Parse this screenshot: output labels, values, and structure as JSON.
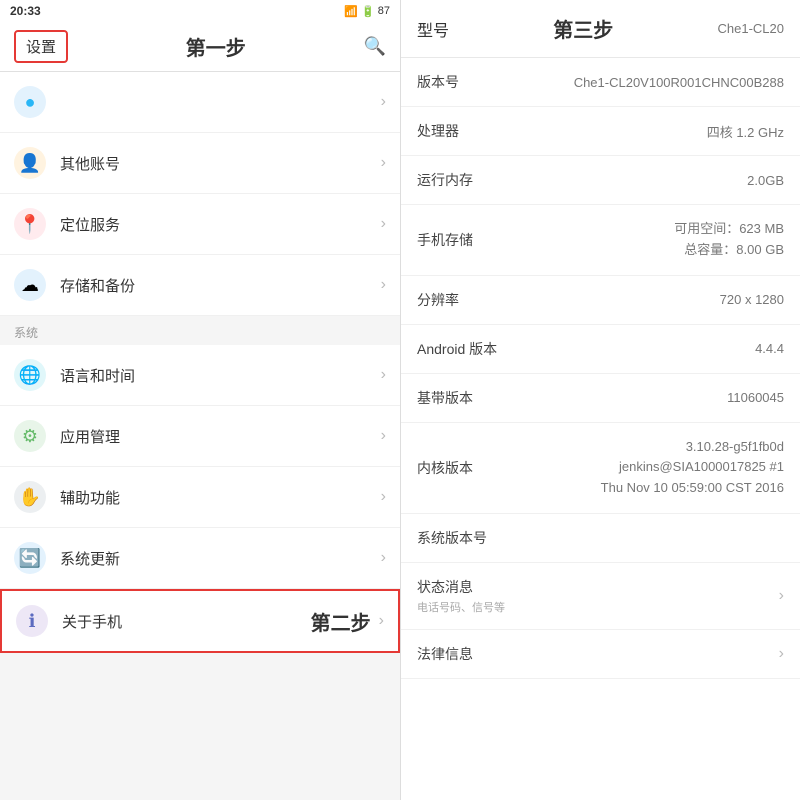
{
  "left": {
    "status_bar": {
      "time": "20:33",
      "battery": "87",
      "icons": "● ▣ ▣"
    },
    "top_bar": {
      "settings_label": "设置",
      "title": "第一步",
      "search_icon": "🔍"
    },
    "sections": [
      {
        "label": "",
        "items": [
          {
            "icon": "⬤",
            "icon_color": "#29b6f6",
            "label": "",
            "has_label": false
          }
        ]
      },
      {
        "label": "",
        "items": [
          {
            "icon": "👤",
            "icon_color": "#ff9800",
            "label": "其他账号",
            "has_label": true
          },
          {
            "icon": "📍",
            "icon_color": "#f44336",
            "label": "定位服务",
            "has_label": true
          },
          {
            "icon": "☁",
            "icon_color": "#42a5f5",
            "label": "存储和备份",
            "has_label": true
          }
        ]
      },
      {
        "label": "系统",
        "items": [
          {
            "icon": "🌐",
            "icon_color": "#26c6da",
            "label": "语言和时间",
            "has_label": true
          },
          {
            "icon": "⚙",
            "icon_color": "#66bb6a",
            "label": "应用管理",
            "has_label": true
          },
          {
            "icon": "✋",
            "icon_color": "#78909c",
            "label": "辅助功能",
            "has_label": true
          },
          {
            "icon": "🔄",
            "icon_color": "#42a5f5",
            "label": "系统更新",
            "has_label": true
          }
        ]
      }
    ],
    "about_phone": {
      "icon": "ℹ",
      "icon_color": "#5c6bc0",
      "label": "关于手机",
      "step_label": "第二步"
    }
  },
  "right": {
    "header": {
      "left_label": "型号",
      "title": "第三步",
      "right_value": "Che1-CL20"
    },
    "rows": [
      {
        "label": "版本号",
        "value": "Che1-CL20V100R001CHNC00B288",
        "multi": false,
        "clickable": false
      },
      {
        "label": "处理器",
        "value": "四核 1.2 GHz",
        "multi": false,
        "clickable": false
      },
      {
        "label": "运行内存",
        "value": "2.0GB",
        "multi": false,
        "clickable": false
      },
      {
        "label": "手机存储",
        "value": "可用空间：623 MB\n总容量：8.00 GB",
        "multi": true,
        "clickable": false
      },
      {
        "label": "分辨率",
        "value": "720 x 1280",
        "multi": false,
        "clickable": false
      },
      {
        "label": "Android 版本",
        "value": "4.4.4",
        "multi": false,
        "clickable": false
      },
      {
        "label": "基带版本",
        "value": "11060045",
        "multi": false,
        "clickable": false
      },
      {
        "label": "内核版本",
        "value": "3.10.28-g5f1fb0d\njenkins@SIA1000017825 #1\nThu Nov 10 05:59:00 CST 2016",
        "multi": true,
        "clickable": false
      },
      {
        "label": "系统版本号",
        "value": "",
        "multi": false,
        "clickable": false
      },
      {
        "label": "状态消息",
        "sub_label": "电话号码、信号等",
        "value": "",
        "multi": false,
        "clickable": true
      },
      {
        "label": "法律信息",
        "value": "",
        "multi": false,
        "clickable": true
      }
    ]
  }
}
